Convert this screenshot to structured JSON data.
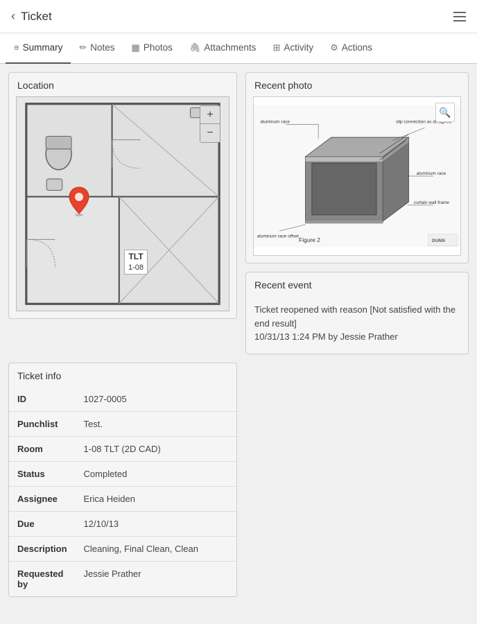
{
  "header": {
    "back_label": "Ticket",
    "hamburger": "menu"
  },
  "tabs": [
    {
      "id": "summary",
      "label": "Summary",
      "icon": "≡",
      "active": true
    },
    {
      "id": "notes",
      "label": "Notes",
      "icon": "✏"
    },
    {
      "id": "photos",
      "label": "Photos",
      "icon": "▦"
    },
    {
      "id": "attachments",
      "label": "Attachments",
      "icon": "📎"
    },
    {
      "id": "activity",
      "label": "Activity",
      "icon": "⊞"
    },
    {
      "id": "actions",
      "label": "Actions",
      "icon": "⚙"
    }
  ],
  "location": {
    "title": "Location",
    "room_name": "TLT",
    "room_number": "1-08"
  },
  "recent_photo": {
    "title": "Recent photo",
    "figure_label": "Figure 2",
    "brand": "DUNN"
  },
  "recent_event": {
    "title": "Recent event",
    "body": "Ticket reopened with reason [Not satisfied with the end result]",
    "timestamp": "10/31/13 1:24 PM by Jessie Prather"
  },
  "ticket_info": {
    "title": "Ticket info",
    "rows": [
      {
        "label": "ID",
        "value": "1027-0005",
        "is_link": false
      },
      {
        "label": "Punchlist",
        "value": "Test.",
        "is_link": false
      },
      {
        "label": "Room",
        "value": "1-08 TLT (2D CAD)",
        "is_link": false
      },
      {
        "label": "Status",
        "value": "Completed",
        "is_link": false
      },
      {
        "label": "Assignee",
        "value": "Erica Heiden",
        "is_link": true
      },
      {
        "label": "Due",
        "value": "12/10/13",
        "is_link": false
      },
      {
        "label": "Description",
        "value": "Cleaning, Final Clean, Clean",
        "is_link": false
      },
      {
        "label": "Requested by",
        "value": "Jessie Prather",
        "is_link": false
      }
    ]
  }
}
